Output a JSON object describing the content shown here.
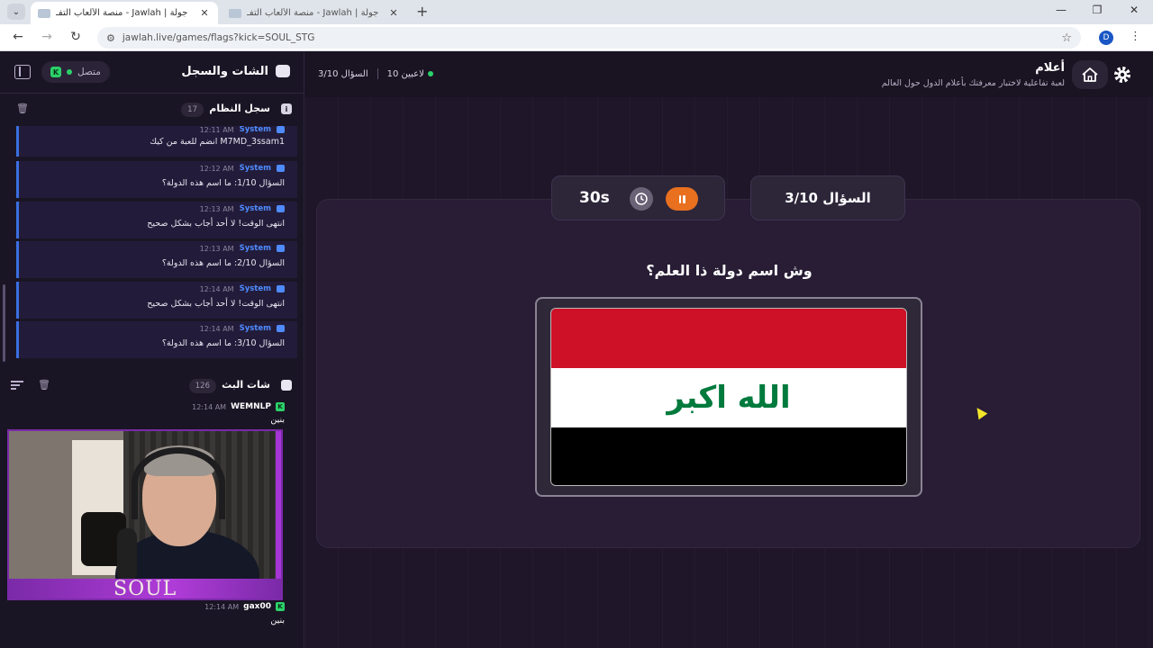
{
  "browser": {
    "tabs": [
      {
        "title": "جولة | Jawlah - منصة الألعاب التفـ",
        "active": true
      },
      {
        "title": "جولة | Jawlah - منصة الألعاب التفـ",
        "active": false
      }
    ],
    "url": "jawlah.live/games/flags?kick=SOUL_STG",
    "profile_initial": "D"
  },
  "left_panel": {
    "title": "الشات والسجل",
    "connection_status": "متصل",
    "system_log": {
      "title": "سجل النظام",
      "count": "17",
      "messages": [
        {
          "sender": "System",
          "time": "12:11 AM",
          "text": "M7MD_3ssam1 انضم للعبة من كيك"
        },
        {
          "sender": "System",
          "time": "12:12 AM",
          "text": "السؤال 1/10: ما اسم هذه الدولة؟"
        },
        {
          "sender": "System",
          "time": "12:13 AM",
          "text": "انتهى الوقت! لا أحد أجاب بشكل صحيح"
        },
        {
          "sender": "System",
          "time": "12:13 AM",
          "text": "السؤال 2/10: ما اسم هذه الدولة؟"
        },
        {
          "sender": "System",
          "time": "12:14 AM",
          "text": "انتهى الوقت! لا أحد أجاب بشكل صحيح"
        },
        {
          "sender": "System",
          "time": "12:14 AM",
          "text": "السؤال 3/10: ما اسم هذه الدولة؟"
        }
      ]
    },
    "stream_chat": {
      "title": "شات البث",
      "count": "126",
      "messages": [
        {
          "user": "WEMNLP",
          "time": "12:14 AM",
          "text": "بنين"
        },
        {
          "user": "gax00",
          "time": "12:14 AM",
          "text": "بنين"
        }
      ]
    },
    "webcam": {
      "overlay_text": "SOUL"
    }
  },
  "game": {
    "title": "أعلام",
    "subtitle": "لعبة تفاعلية لاختبار معرفتك بأعلام الدول حول العالم",
    "players": "10 لاعبين",
    "question_status": "السؤال 3/10",
    "question_pill": "السؤال 3/10",
    "timer": "30s",
    "question": "وش اسم دولة ذا العلم؟",
    "flag": {
      "stripes": [
        "#ce1126",
        "#ffffff",
        "#000000"
      ],
      "inscription": "الله اكبر",
      "inscription_color": "#007a3d"
    }
  },
  "colors": {
    "accent_green": "#2bd16a",
    "system_blue": "#4f8bff",
    "pause_orange": "#e8701f"
  }
}
